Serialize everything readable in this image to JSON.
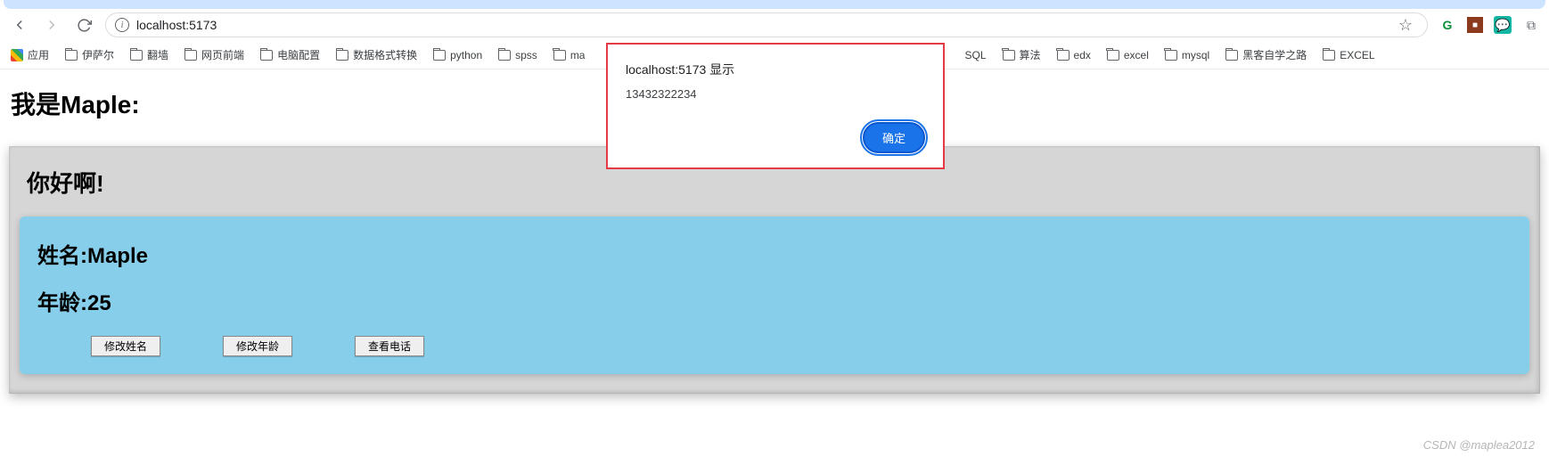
{
  "browser": {
    "url": "localhost:5173",
    "ext_icons": [
      "G",
      "■",
      "💬",
      "⧉"
    ]
  },
  "bookmarks": {
    "apps_label": "应用",
    "items": [
      "伊萨尔",
      "翻墙",
      "网页前端",
      "电脑配置",
      "数据格式转换",
      "python",
      "spss",
      "ma",
      "SQL",
      "算法",
      "edx",
      "excel",
      "mysql",
      "黑客自学之路",
      "EXCEL"
    ]
  },
  "page": {
    "title": "我是Maple:",
    "card_title": "你好啊!",
    "name_label": "姓名:",
    "name_value": "Maple",
    "age_label": "年龄:",
    "age_value": "25",
    "buttons": {
      "edit_name": "修改姓名",
      "edit_age": "修改年龄",
      "view_phone": "查看电话"
    }
  },
  "dialog": {
    "title": "localhost:5173 显示",
    "message": "13432322234",
    "ok": "确定"
  },
  "watermark": "CSDN @maplea2012"
}
